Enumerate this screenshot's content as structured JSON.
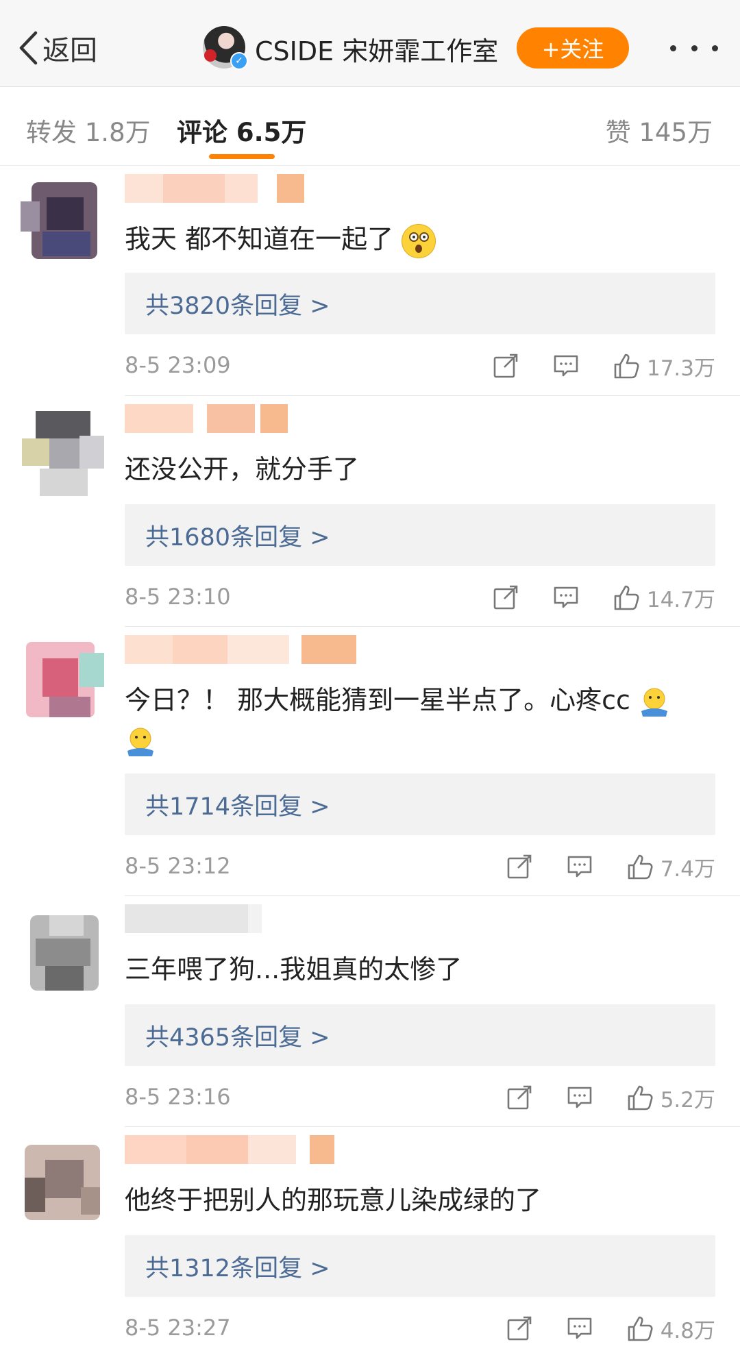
{
  "header": {
    "back_label": "返回",
    "title": "CSIDE 宋妍霏工作室",
    "follow_label": "+关注"
  },
  "tabs": {
    "repost": "转发 1.8万",
    "comment": "评论 6.5万",
    "like": "赞 145万"
  },
  "colors": {
    "accent": "#ff8200",
    "link": "#4b6b95",
    "meta": "#9b9b9b"
  },
  "comments": [
    {
      "text": "我天 都不知道在一起了",
      "emoji": "surprised-face",
      "replies": "共3820条回复 >",
      "time": "8-5 23:09",
      "likes": "17.3万"
    },
    {
      "text": "还没公开，就分手了",
      "replies": "共1680条回复 >",
      "time": "8-5 23:10",
      "likes": "14.7万"
    },
    {
      "text": "今日？！ 那大概能猜到一星半点了。心疼cc",
      "emoji": "hug-face",
      "replies": "共1714条回复 >",
      "time": "8-5 23:12",
      "likes": "7.4万"
    },
    {
      "text": "三年喂了狗...我姐真的太惨了",
      "replies": "共4365条回复 >",
      "time": "8-5 23:16",
      "likes": "5.2万"
    },
    {
      "text": "他终于把别人的那玩意儿染成绿的了",
      "replies": "共1312条回复 >",
      "time": "8-5 23:27",
      "likes": "4.8万"
    }
  ]
}
